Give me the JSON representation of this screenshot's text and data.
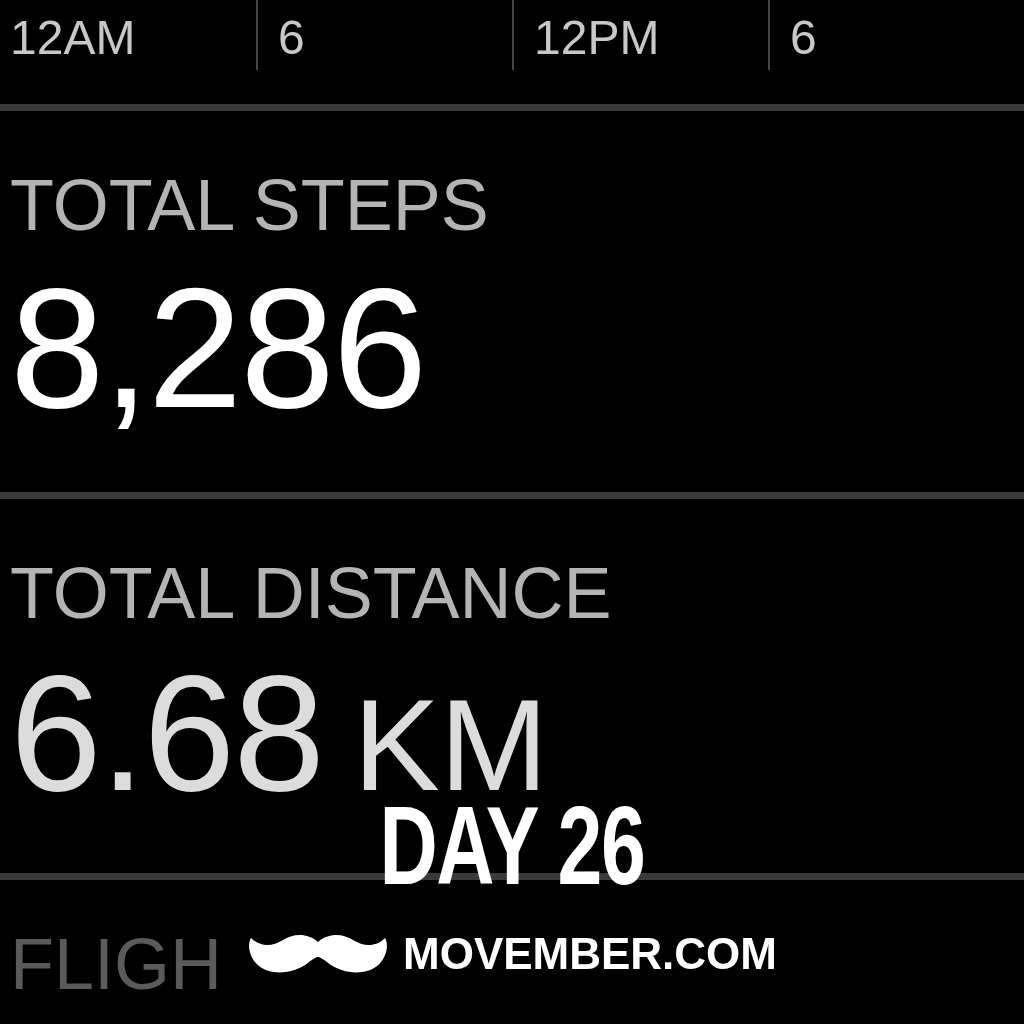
{
  "chart_axis": {
    "labels": [
      "12AM",
      "6",
      "12PM",
      "6"
    ]
  },
  "metrics": [
    {
      "kind": "value",
      "label": "TOTAL STEPS",
      "value": "8,286"
    },
    {
      "kind": "value_unit",
      "label": "TOTAL DISTANCE",
      "value": "6.68",
      "unit": "KM"
    },
    {
      "kind": "label_only",
      "label": "FLIGH"
    }
  ],
  "overlay": {
    "title": "DAY 26",
    "site": "MOVEMBER.COM"
  }
}
